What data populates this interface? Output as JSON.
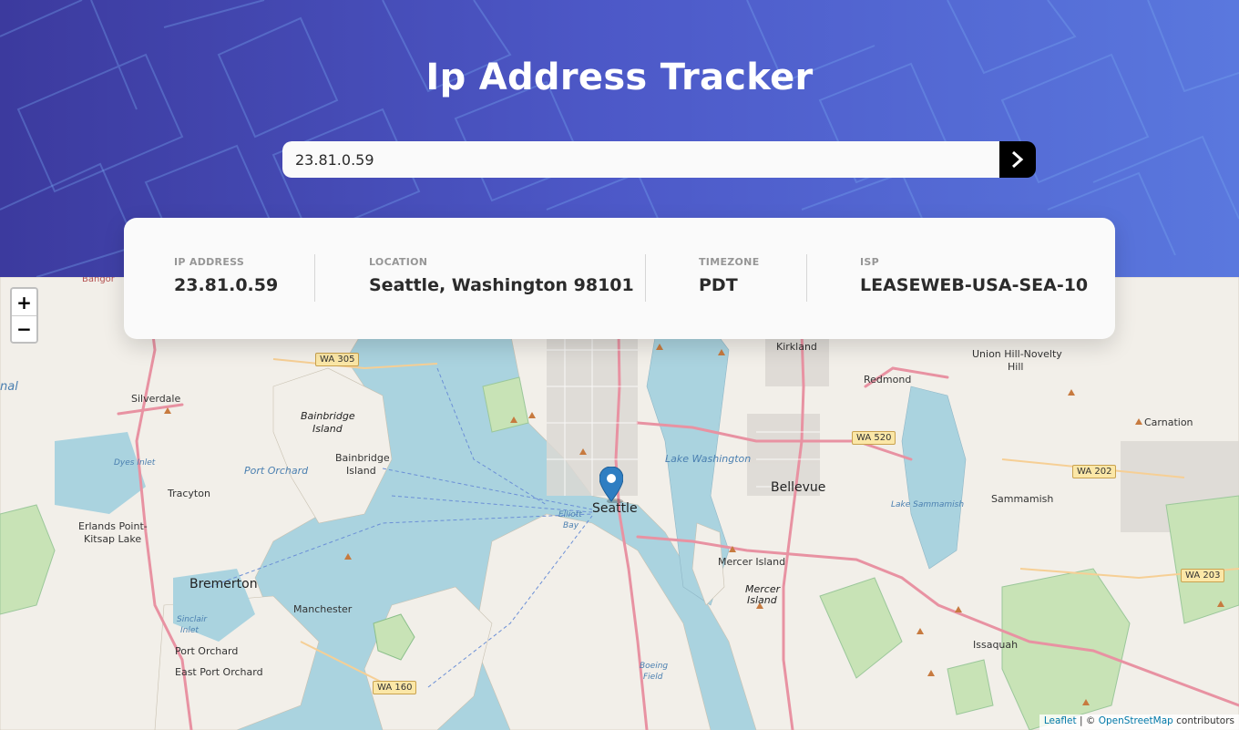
{
  "header": {
    "title": "Ip Address Tracker",
    "search": {
      "value": "23.81.0.59",
      "submit_icon": "chevron-right-icon"
    }
  },
  "info": {
    "ip": {
      "label": "IP ADDRESS",
      "value": "23.81.0.59"
    },
    "location": {
      "label": "LOCATION",
      "value": "Seattle, Washington 98101"
    },
    "timezone": {
      "label": "TIMEZONE",
      "value": "PDT"
    },
    "isp": {
      "label": "ISP",
      "value": "LEASEWEB-USA-SEA-10"
    }
  },
  "map": {
    "zoom_in": "+",
    "zoom_out": "−",
    "marker_icon": "map-pin-icon",
    "labels": {
      "seattle": "Seattle",
      "bellevue": "Bellevue",
      "bremerton": "Bremerton",
      "kirkland": "Kirkland",
      "redmond": "Redmond",
      "union_hill": "Union Hill-Novelty",
      "union_hill2": "Hill",
      "carnation": "Carnation",
      "sammamish": "Sammamish",
      "issaquah": "Issaquah",
      "mercer_island": "Mercer Island",
      "mercer_island_park1": "Mercer",
      "mercer_island_park2": "Island",
      "bainbridge_island": "Bainbridge",
      "bainbridge_island2": "Island",
      "bainbridge_island_town1": "Bainbridge",
      "bainbridge_island_town2": "Island",
      "silverdale": "Silverdale",
      "tracyton": "Tracyton",
      "erlands1": "Erlands Point-",
      "erlands2": "Kitsap Lake",
      "manchester": "Manchester",
      "port_orchard": "Port Orchard",
      "east_port_orchard": "East Port Orchard",
      "bangor": "Bangor",
      "lake_washington": "Lake Washington",
      "lake_sammamish": "Lake Sammamish",
      "port_orchard_water": "Port Orchard",
      "dyes_inlet": "Dyes Inlet",
      "sinclair1": "Sinclair",
      "sinclair2": "Inlet",
      "elliott1": "Elliott",
      "elliott2": "Bay",
      "canal": "nal",
      "boeing1": "Boeing",
      "boeing2": "Field",
      "wa305": "WA 305",
      "wa520": "WA 520",
      "wa202": "WA 202",
      "wa203": "WA 203",
      "wa160": "WA 160"
    }
  },
  "attribution": {
    "leaflet": "Leaflet",
    "sep": " | © ",
    "osm": "OpenStreetMap",
    "contributors": " contributors"
  }
}
